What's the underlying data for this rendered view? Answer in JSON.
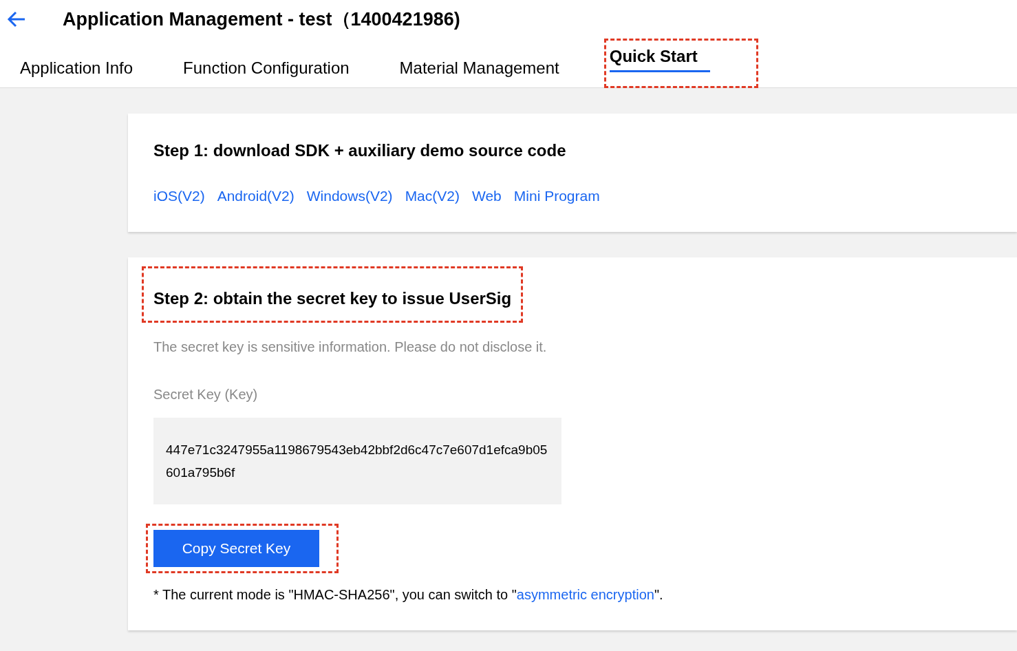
{
  "header": {
    "title": "Application Management - test（1400421986)"
  },
  "tabs": [
    {
      "label": "Application Info",
      "selected": false,
      "highlighted": false
    },
    {
      "label": "Function Configuration",
      "selected": false,
      "highlighted": false
    },
    {
      "label": "Material Management",
      "selected": false,
      "highlighted": false
    },
    {
      "label": "Quick Start",
      "selected": true,
      "highlighted": true
    }
  ],
  "step1": {
    "title": "Step 1: download SDK + auxiliary demo source code",
    "links": [
      "iOS(V2)",
      "Android(V2)",
      "Windows(V2)",
      "Mac(V2)",
      "Web",
      "Mini Program"
    ]
  },
  "step2": {
    "title": "Step 2: obtain the secret key to issue UserSig",
    "title_highlighted": true,
    "hint": "The secret key is sensitive information. Please do not disclose it.",
    "key_label": "Secret Key (Key)",
    "key_value": "447e71c3247955a1198679543eb42bbf2d6c47c7e607d1efca9b05601a795b6f",
    "button": "Copy Secret Key",
    "button_highlighted": true,
    "note_before": "* The current mode is \"HMAC-SHA256\", you can switch to \"",
    "note_link": "asymmetric encryption",
    "note_after": "\"."
  }
}
